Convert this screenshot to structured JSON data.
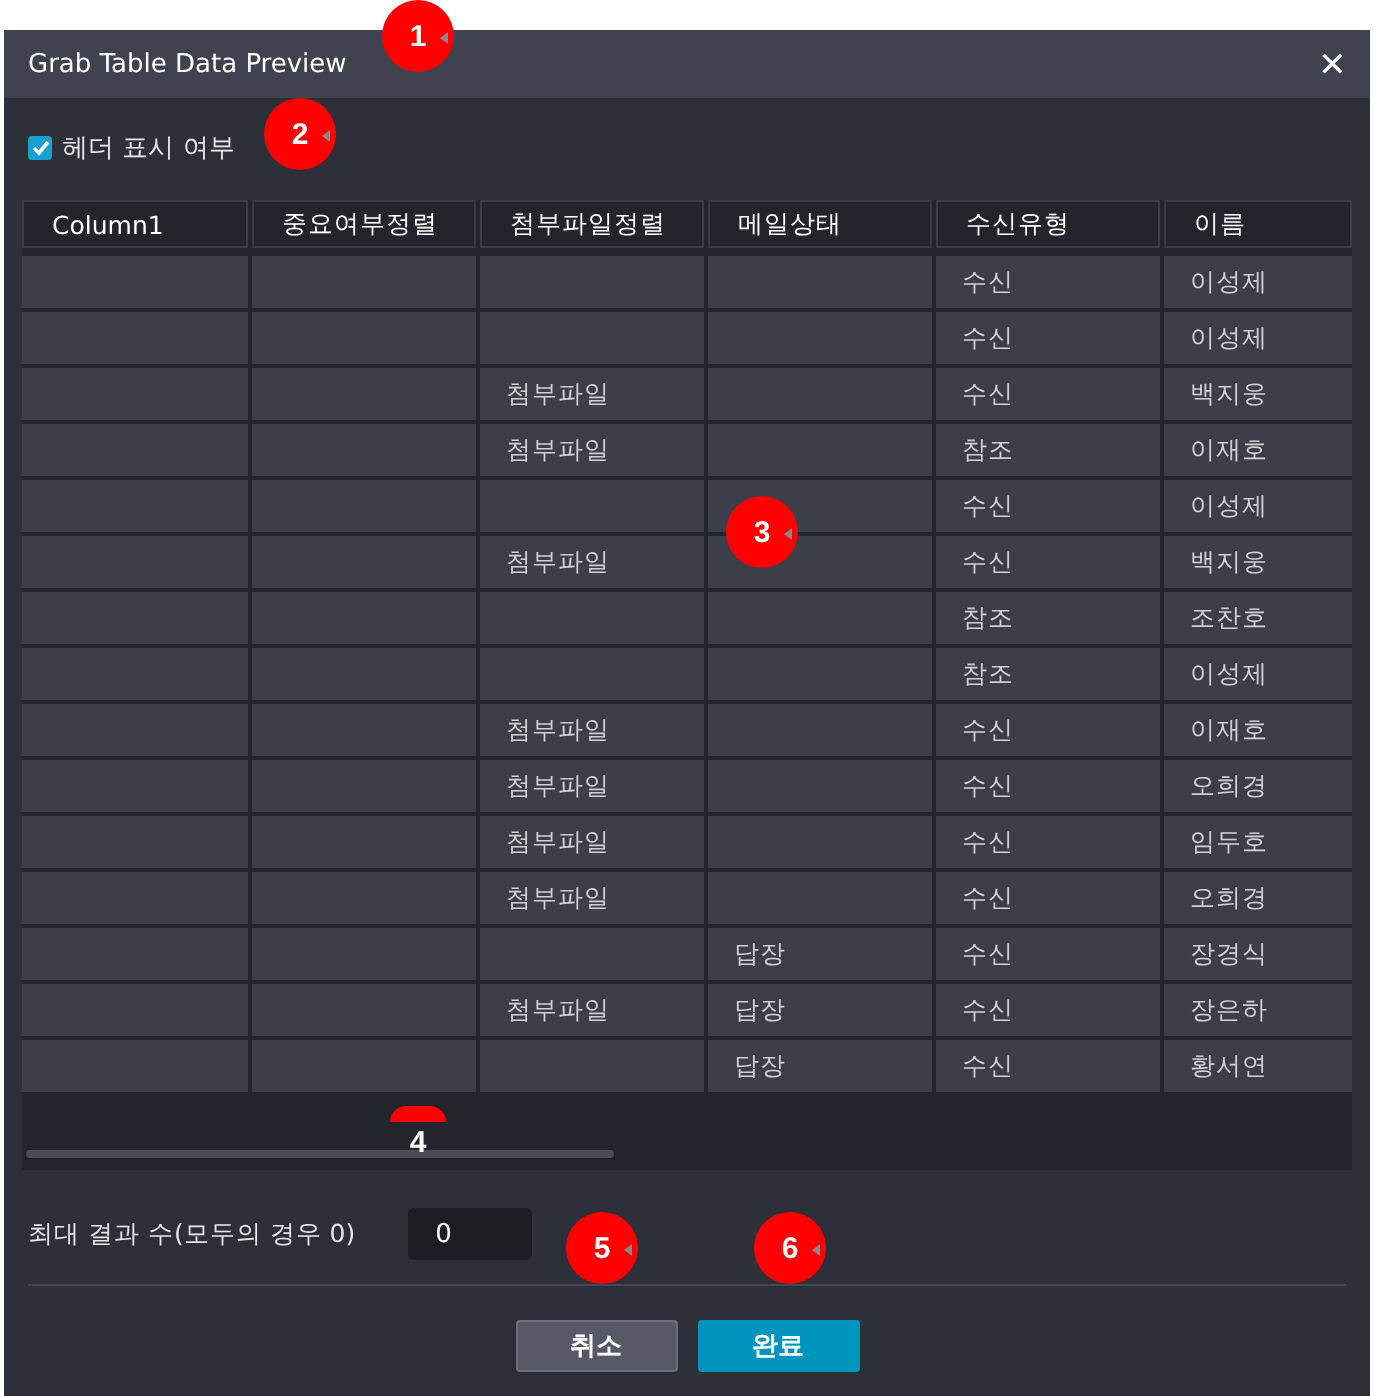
{
  "window": {
    "title": "Grab Table Data Preview",
    "close": "✕"
  },
  "header_toggle": {
    "label": "헤더 표시 여부",
    "checked": true
  },
  "table": {
    "columns": [
      "Column1",
      "중요여부정렬",
      "첨부파일정렬",
      "메일상태",
      "수신유형",
      "이름"
    ],
    "rows": [
      {
        "receive_type": "수신",
        "name": "이성제"
      },
      {
        "receive_type": "수신",
        "name": "이성제"
      },
      {
        "attachment": "첨부파일",
        "receive_type": "수신",
        "name": "백지웅"
      },
      {
        "attachment": "첨부파일",
        "receive_type": "참조",
        "name": "이재호"
      },
      {
        "receive_type": "수신",
        "name": "이성제"
      },
      {
        "attachment": "첨부파일",
        "receive_type": "수신",
        "name": "백지웅"
      },
      {
        "receive_type": "참조",
        "name": "조찬호"
      },
      {
        "receive_type": "참조",
        "name": "이성제"
      },
      {
        "attachment": "첨부파일",
        "receive_type": "수신",
        "name": "이재호"
      },
      {
        "attachment": "첨부파일",
        "receive_type": "수신",
        "name": "오희경"
      },
      {
        "attachment": "첨부파일",
        "receive_type": "수신",
        "name": "임두호"
      },
      {
        "attachment": "첨부파일",
        "receive_type": "수신",
        "name": "오희경"
      },
      {
        "mail_status": "답장",
        "receive_type": "수신",
        "name": "장경식"
      },
      {
        "attachment": "첨부파일",
        "mail_status": "답장",
        "receive_type": "수신",
        "name": "장은하"
      },
      {
        "mail_status": "답장",
        "receive_type": "수신",
        "name": "황서연"
      }
    ]
  },
  "max_results": {
    "label": "최대 결과 수(모두의 경우 0)",
    "value": "0"
  },
  "buttons": [
    {
      "label": "취소",
      "kind": "cancel"
    },
    {
      "label": "완료",
      "kind": "primary"
    }
  ],
  "annotations": [
    {
      "label": "1",
      "kind": "full"
    },
    {
      "label": "2",
      "kind": "full"
    },
    {
      "label": "3",
      "kind": "full"
    },
    {
      "label": "4",
      "kind": "partial"
    },
    {
      "label": "5",
      "kind": "full"
    },
    {
      "label": "6",
      "kind": "full"
    }
  ]
}
